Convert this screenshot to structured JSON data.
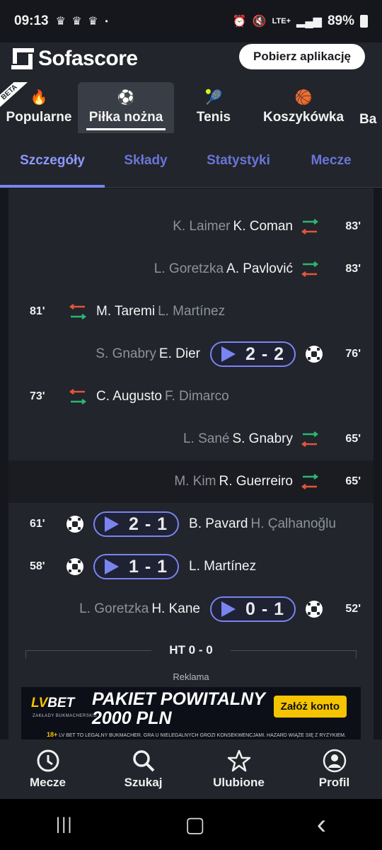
{
  "status_bar": {
    "time": "09:13",
    "notification_icons": "♛ ♛ ♛",
    "dot": "•",
    "network": "LTE+",
    "battery": "89%"
  },
  "header": {
    "brand": "Sofascore",
    "download_label": "Pobierz aplikację",
    "beta_badge": "BETA",
    "sport_tabs": [
      {
        "label": "Popularne",
        "icon": "flame-icon",
        "glyph": "🔥"
      },
      {
        "label": "Piłka nożna",
        "icon": "soccer-ball-icon",
        "glyph": "⚽"
      },
      {
        "label": "Tenis",
        "icon": "tennis-icon",
        "glyph": "🎾"
      },
      {
        "label": "Koszykówka",
        "icon": "basketball-icon",
        "glyph": "🏀"
      },
      {
        "label": "Ba",
        "icon": "",
        "glyph": ""
      }
    ]
  },
  "detail_tabs": [
    "Szczegóły",
    "Składy",
    "Statystyki",
    "Mecze"
  ],
  "events": [
    {
      "type": "sub",
      "side": "right",
      "primary": "K. Coman",
      "secondary": "K. Laimer",
      "minute": "83'"
    },
    {
      "type": "sub",
      "side": "right",
      "primary": "A. Pavlović",
      "secondary": "L. Goretzka",
      "minute": "83'"
    },
    {
      "type": "sub",
      "side": "left",
      "primary": "M. Taremi",
      "secondary": "L. Martínez",
      "minute": "81'"
    },
    {
      "type": "goal",
      "side": "right",
      "primary": "E. Dier",
      "secondary": "S. Gnabry",
      "score": "2 - 2",
      "minute": "76'"
    },
    {
      "type": "sub",
      "side": "left",
      "primary": "C. Augusto",
      "secondary": "F. Dimarco",
      "minute": "73'"
    },
    {
      "type": "sub",
      "side": "right",
      "primary": "S. Gnabry",
      "secondary": "L. Sané",
      "minute": "65'"
    },
    {
      "type": "sub",
      "side": "right",
      "primary": "R. Guerreiro",
      "secondary": "M. Kim",
      "minute": "65'"
    },
    {
      "type": "goal",
      "side": "left",
      "primary": "B. Pavard",
      "secondary": "H. Çalhanoğlu",
      "score": "2 - 1",
      "minute": "61'"
    },
    {
      "type": "goal",
      "side": "left",
      "primary": "L. Martínez",
      "secondary": "",
      "score": "1 - 1",
      "minute": "58'"
    },
    {
      "type": "goal",
      "side": "right",
      "primary": "H. Kane",
      "secondary": "L. Goretzka",
      "score": "0 - 1",
      "minute": "52'"
    }
  ],
  "halftime_label": "HT 0 - 0",
  "ad": {
    "label": "Reklama",
    "logo": "LV",
    "logo_rest": "BET",
    "logo_sub": "ZAKŁADY BUKMACHERSKIE",
    "title_line1": "PAKIET POWITALNY",
    "title_line2": "2000 PLN",
    "cta": "Załóż konto",
    "age": "18+",
    "fine_print": "LV BET TO LEGALNY BUKMACHER. GRA U NIELEGALNYCH GROZI KONSEKWENCJAMI. HAZARD WIĄŻE SIĘ Z RYZYKIEM."
  },
  "bottom_nav": [
    {
      "label": "Mecze",
      "icon": "clock-icon"
    },
    {
      "label": "Szukaj",
      "icon": "search-icon"
    },
    {
      "label": "Ulubione",
      "icon": "star-icon"
    },
    {
      "label": "Profil",
      "icon": "profile-icon"
    }
  ],
  "system_nav": {
    "recents": "|||",
    "home": "▢",
    "back": "‹"
  },
  "colors": {
    "accent": "#7a84f0",
    "sub_in": "#2bb673",
    "sub_out": "#e2553d",
    "ad_yellow": "#f5c400"
  }
}
